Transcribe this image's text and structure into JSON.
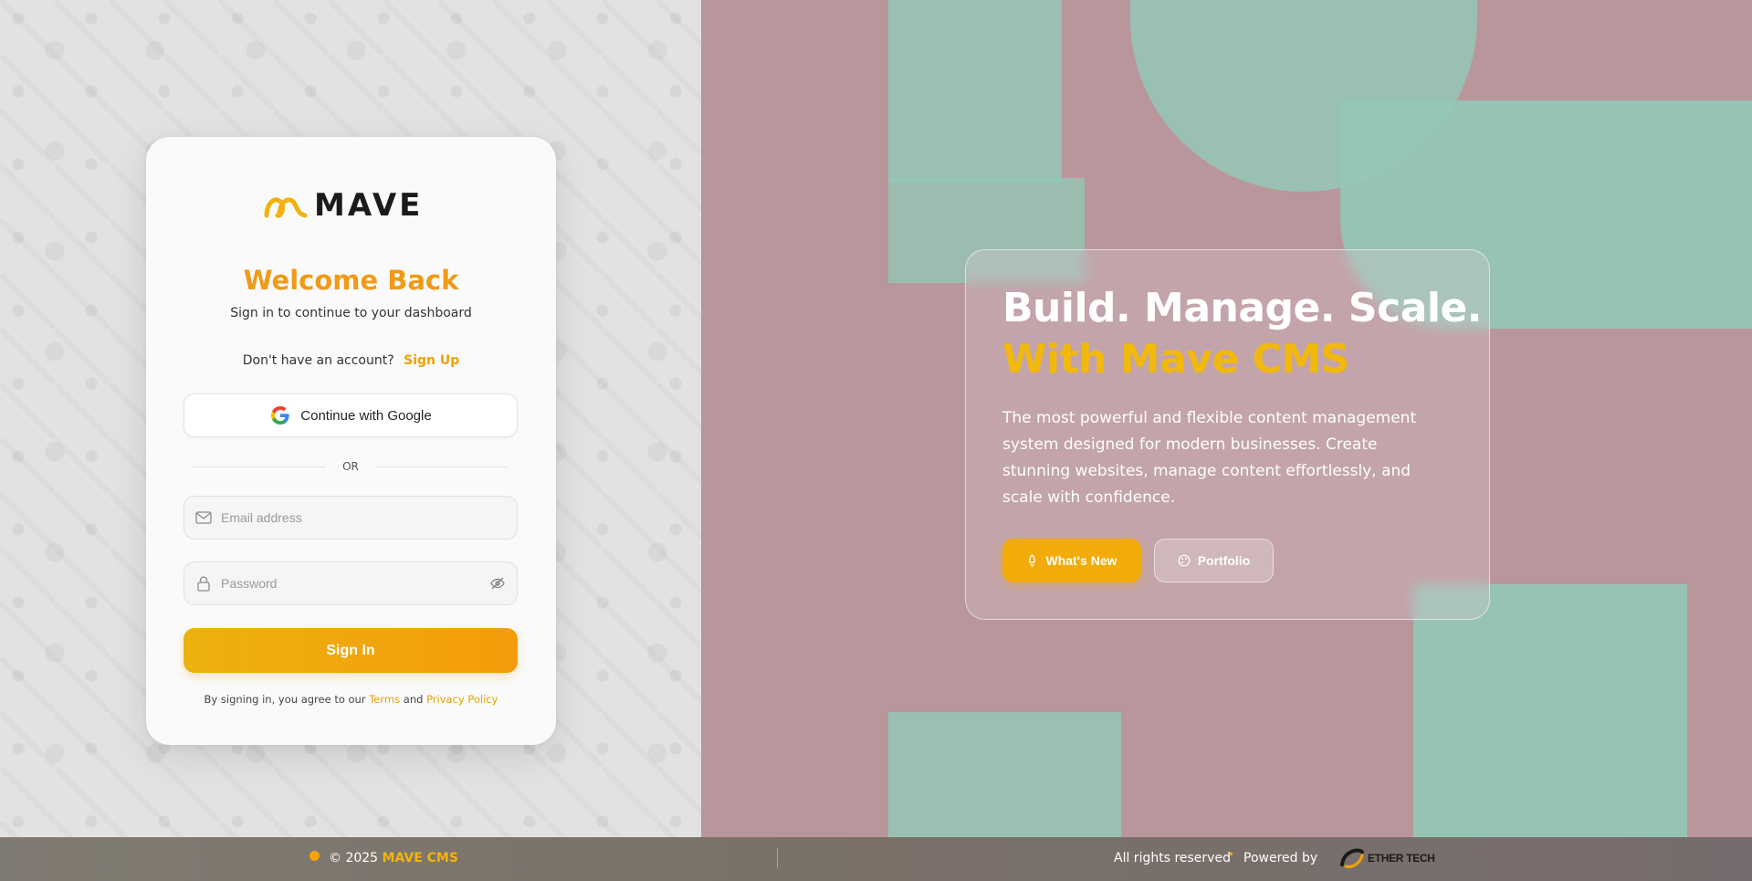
{
  "brand": {
    "logo_text": "MAVE",
    "accent_color": "#f09a18",
    "secondary_accent": "#f2b90d"
  },
  "login": {
    "title": "Welcome Back",
    "subtitle": "Sign in to continue to your dashboard",
    "no_account_text": "Don't have an account?",
    "signup_link": "Sign Up",
    "google_button": "Continue with Google",
    "divider_text": "OR",
    "email_placeholder": "Email address",
    "password_placeholder": "Password",
    "signin_button": "Sign In",
    "terms_prefix": "By signing in, you agree to our",
    "terms_link": "Terms",
    "terms_and": "and",
    "privacy_link": "Privacy Policy",
    "icons": {
      "email": "mail-icon",
      "password": "lock-icon",
      "toggle": "eye-off-icon",
      "google": "google-icon"
    }
  },
  "hero": {
    "headline": "Build. Manage. Scale.",
    "headline_accent": "With Mave CMS",
    "description": "The most powerful and flexible content management system designed for modern businesses. Create stunning websites, manage content effortlessly, and scale with confidence.",
    "primary_button": "What's New",
    "primary_icon": "rocket-icon",
    "secondary_button": "Portfolio",
    "secondary_icon": "palette-icon"
  },
  "footer": {
    "copyright": "© 2025",
    "brand": "MAVE CMS",
    "rights": "All rights reserved",
    "separator": "•",
    "powered_by": "Powered by",
    "company_logo_text": "ETHER TECH"
  }
}
